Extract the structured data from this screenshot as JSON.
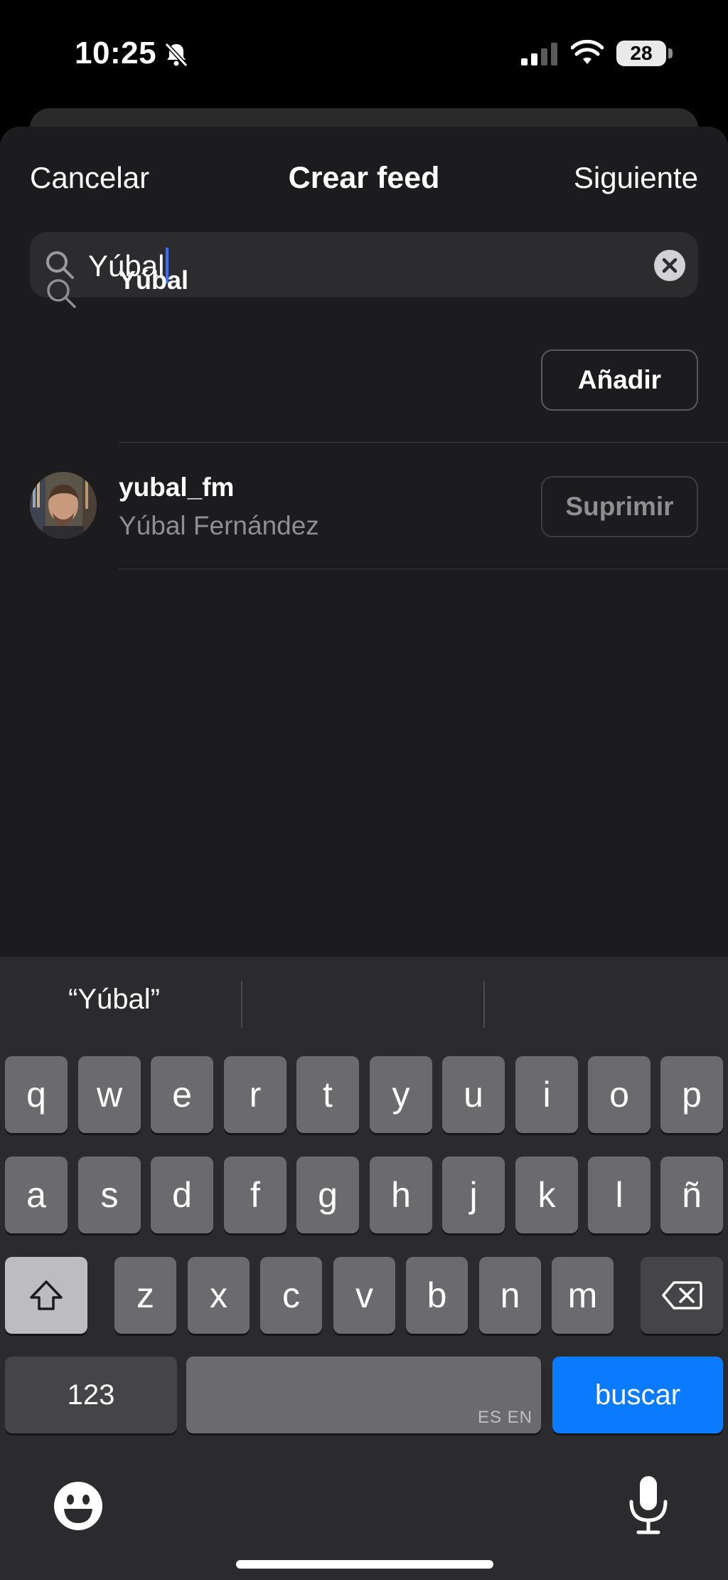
{
  "status_bar": {
    "time": "10:25",
    "battery": "28"
  },
  "header": {
    "cancel": "Cancelar",
    "title": "Crear feed",
    "next": "Siguiente"
  },
  "search": {
    "value": "Yúbal"
  },
  "results": {
    "suggestion": {
      "label": "Yúbal",
      "action": "Añadir"
    },
    "user": {
      "username": "yubal_fm",
      "fullname": "Yúbal Fernández",
      "action": "Suprimir"
    }
  },
  "keyboard": {
    "prediction": "“Yúbal”",
    "row1": [
      "q",
      "w",
      "e",
      "r",
      "t",
      "y",
      "u",
      "i",
      "o",
      "p"
    ],
    "row2": [
      "a",
      "s",
      "d",
      "f",
      "g",
      "h",
      "j",
      "k",
      "l",
      "ñ"
    ],
    "row3": [
      "z",
      "x",
      "c",
      "v",
      "b",
      "n",
      "m"
    ],
    "num_key": "123",
    "space_lang": "ES EN",
    "search_key": "buscar"
  },
  "icons": [
    "bell-slash-icon",
    "signal-icon",
    "wifi-icon",
    "search-icon",
    "clear-icon",
    "shift-icon",
    "backspace-icon",
    "emoji-icon",
    "microphone-icon"
  ],
  "colors": {
    "accent": "#0a7aff",
    "caret": "#3b6cff",
    "sheet": "#1c1c1e"
  }
}
